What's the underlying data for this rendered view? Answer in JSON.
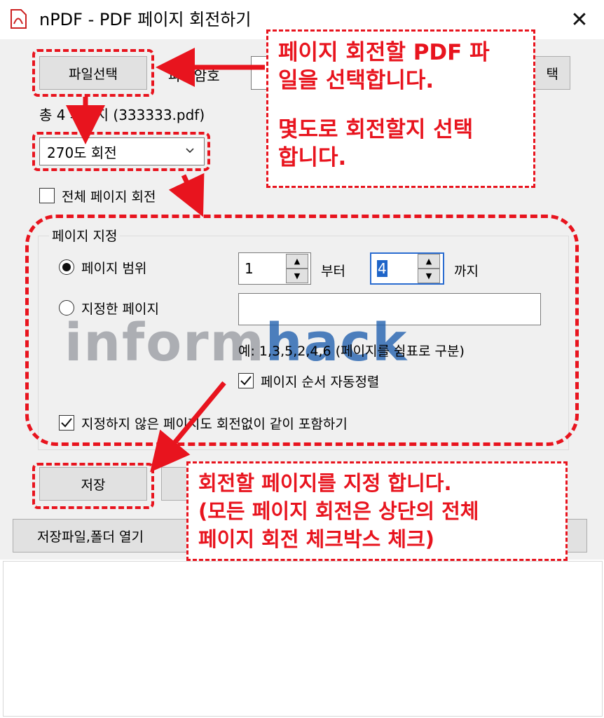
{
  "window": {
    "title": "nPDF - PDF 페이지 회전하기",
    "close_glyph": "✕"
  },
  "file": {
    "select_button": "파일선택",
    "password_label": "파일암호",
    "info": "총 4 페이지 (333333.pdf)",
    "right_button_partial": "택"
  },
  "rotation": {
    "selected": "270도 회전"
  },
  "all_pages_checkbox": {
    "label": "전체 페이지 회전",
    "checked": false
  },
  "page_group": {
    "title": "페이지 지정",
    "range_radio": {
      "label": "페이지 범위",
      "checked": true
    },
    "from_value": "1",
    "from_suffix": "부터",
    "to_value": "4",
    "to_suffix": "까지",
    "specified_radio": {
      "label": "지정한 페이지",
      "checked": false
    },
    "specified_value": "",
    "example": "예: 1,3,5,2,4,6 (페이지를 쉼표로 구분)",
    "auto_sort": {
      "label": "페이지 순서 자동정렬",
      "checked": true
    },
    "include_unspecified": {
      "label": "지정하지 않은 페이지도 회전없이 같이 포함하기",
      "checked": true
    }
  },
  "actions": {
    "save_button": "저장",
    "open_folder_button": "저장파일,폴더 열기"
  },
  "annotations": {
    "callout_top_1": "페이지 회전할 PDF 파",
    "callout_top_2": "일을 선택합니다.",
    "callout_top_3": "몇도로 회전할지 선택",
    "callout_top_4": "합니다.",
    "callout_bottom_1": "회전할 페이지를 지정 합니다.",
    "callout_bottom_2": "(모든 페이지 회전은 상단의 전체",
    "callout_bottom_3": "페이지 회전 체크박스 체크)",
    "highlight_color": "#e8141e"
  },
  "watermark": {
    "part1": "inform",
    "part2": "hack"
  }
}
